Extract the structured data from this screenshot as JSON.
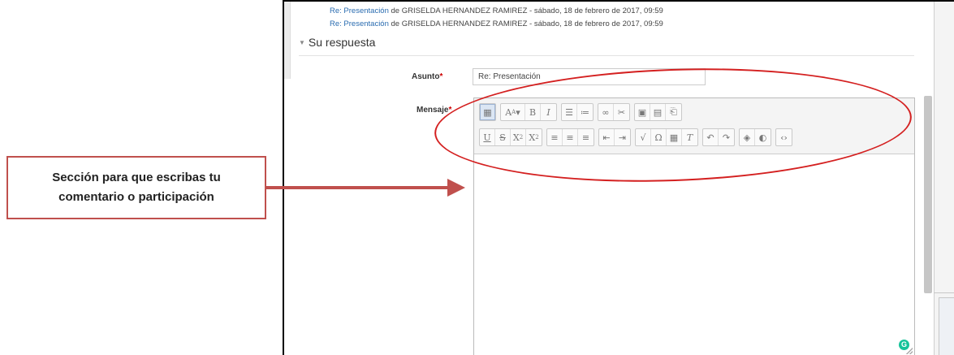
{
  "replies": [
    {
      "link": "Re: Presentación",
      "rest": " de GRISELDA HERNANDEZ RAMIREZ - sábado, 18 de febrero de 2017, 09:59"
    },
    {
      "link": "Re: Presentación",
      "rest": " de GRISELDA HERNANDEZ RAMIREZ - sábado, 18 de febrero de 2017, 09:59"
    }
  ],
  "section": {
    "title": "Su respuesta"
  },
  "form": {
    "subject_label": "Asunto",
    "subject_value": "Re: Presentación",
    "message_label": "Mensaje",
    "required_mark": "*"
  },
  "toolbar": {
    "row1": [
      [
        "expand-toolbar"
      ],
      [
        "font-style",
        "bold",
        "italic"
      ],
      [
        "bullet-list",
        "numbered-list"
      ],
      [
        "link",
        "unlink"
      ],
      [
        "image",
        "media",
        "paste"
      ]
    ],
    "row2": [
      [
        "underline",
        "strikethrough",
        "subscript",
        "superscript"
      ],
      [
        "align-left",
        "align-center",
        "align-right"
      ],
      [
        "outdent",
        "indent"
      ],
      [
        "equation",
        "special-char",
        "table",
        "clear-format"
      ],
      [
        "undo",
        "redo"
      ],
      [
        "accessibility",
        "screenreader"
      ],
      [
        "html-source"
      ]
    ]
  },
  "annotation": {
    "callout_text": "Sección para que escribas tu comentario o participación",
    "accent_color": "#c0504d",
    "ellipse_color": "#d42020"
  },
  "grammarly": {
    "glyph": "G"
  }
}
